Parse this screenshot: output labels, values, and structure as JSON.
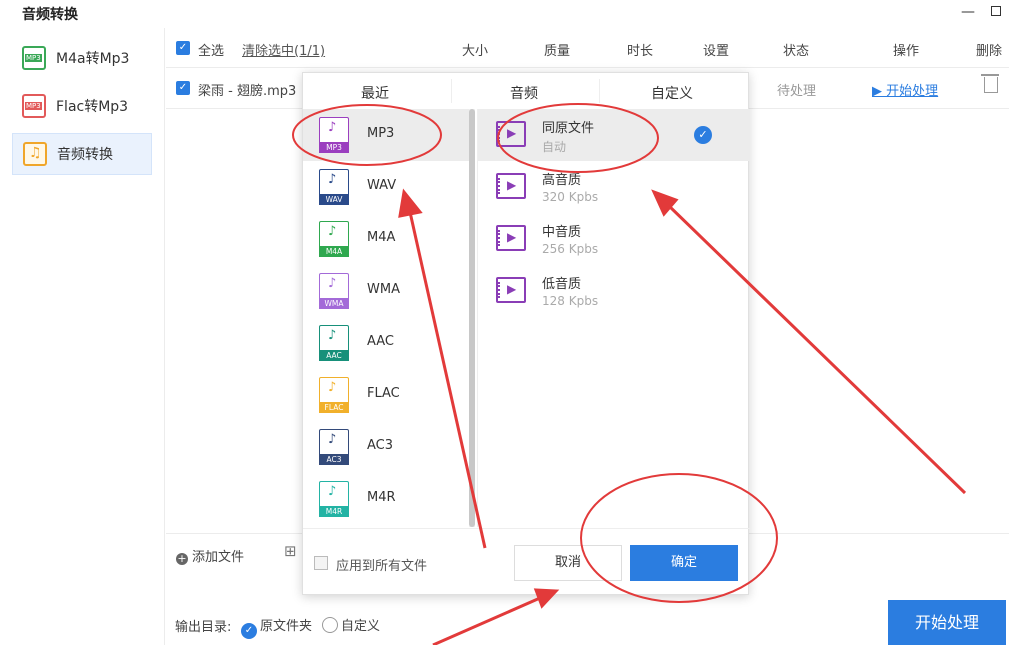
{
  "window": {
    "title": "音频转换",
    "minimize": "—"
  },
  "sidebar": {
    "items": [
      {
        "label": "M4a转Mp3",
        "icon": "m4a-to-mp3-icon"
      },
      {
        "label": "Flac转Mp3",
        "icon": "flac-to-mp3-icon"
      },
      {
        "label": "音频转换",
        "icon": "audio-convert-icon",
        "active": true
      }
    ]
  },
  "header": {
    "select_all": "全选",
    "clear_selection": "清除选中(1/1)",
    "columns": [
      "大小",
      "质量",
      "时长",
      "设置",
      "状态",
      "操作",
      "删除"
    ]
  },
  "file_row": {
    "name": "梁雨 - 翅膀.mp3",
    "status": "待处理",
    "action": "▶ 开始处理"
  },
  "bottom": {
    "add_file": "添加文件",
    "output_label": "输出目录:",
    "output_option_original": "原文件夹",
    "output_option_custom": "自定义",
    "start_button": "开始处理"
  },
  "popup": {
    "tabs": [
      "最近",
      "音频",
      "自定义"
    ],
    "formats": [
      {
        "label": "MP3",
        "tag": "MP3",
        "color": "#9b3fbf",
        "selected": true
      },
      {
        "label": "WAV",
        "tag": "WAV",
        "color": "#2a4a8a"
      },
      {
        "label": "M4A",
        "tag": "M4A",
        "color": "#2fa84f"
      },
      {
        "label": "WMA",
        "tag": "WMA",
        "color": "#a36ad8"
      },
      {
        "label": "AAC",
        "tag": "AAC",
        "color": "#17907a"
      },
      {
        "label": "FLAC",
        "tag": "FLAC",
        "color": "#f1b02b"
      },
      {
        "label": "AC3",
        "tag": "AC3",
        "color": "#334a7a"
      },
      {
        "label": "M4R",
        "tag": "M4R",
        "color": "#23b3a4"
      }
    ],
    "qualities": [
      {
        "title": "同原文件",
        "sub": "自动",
        "selected": true
      },
      {
        "title": "高音质",
        "sub": "320 Kpbs"
      },
      {
        "title": "中音质",
        "sub": "256 Kpbs"
      },
      {
        "title": "低音质",
        "sub": "128 Kpbs"
      }
    ],
    "apply_all": "应用到所有文件",
    "cancel": "取消",
    "confirm": "确定"
  },
  "annotation_color": "#e23a3a"
}
